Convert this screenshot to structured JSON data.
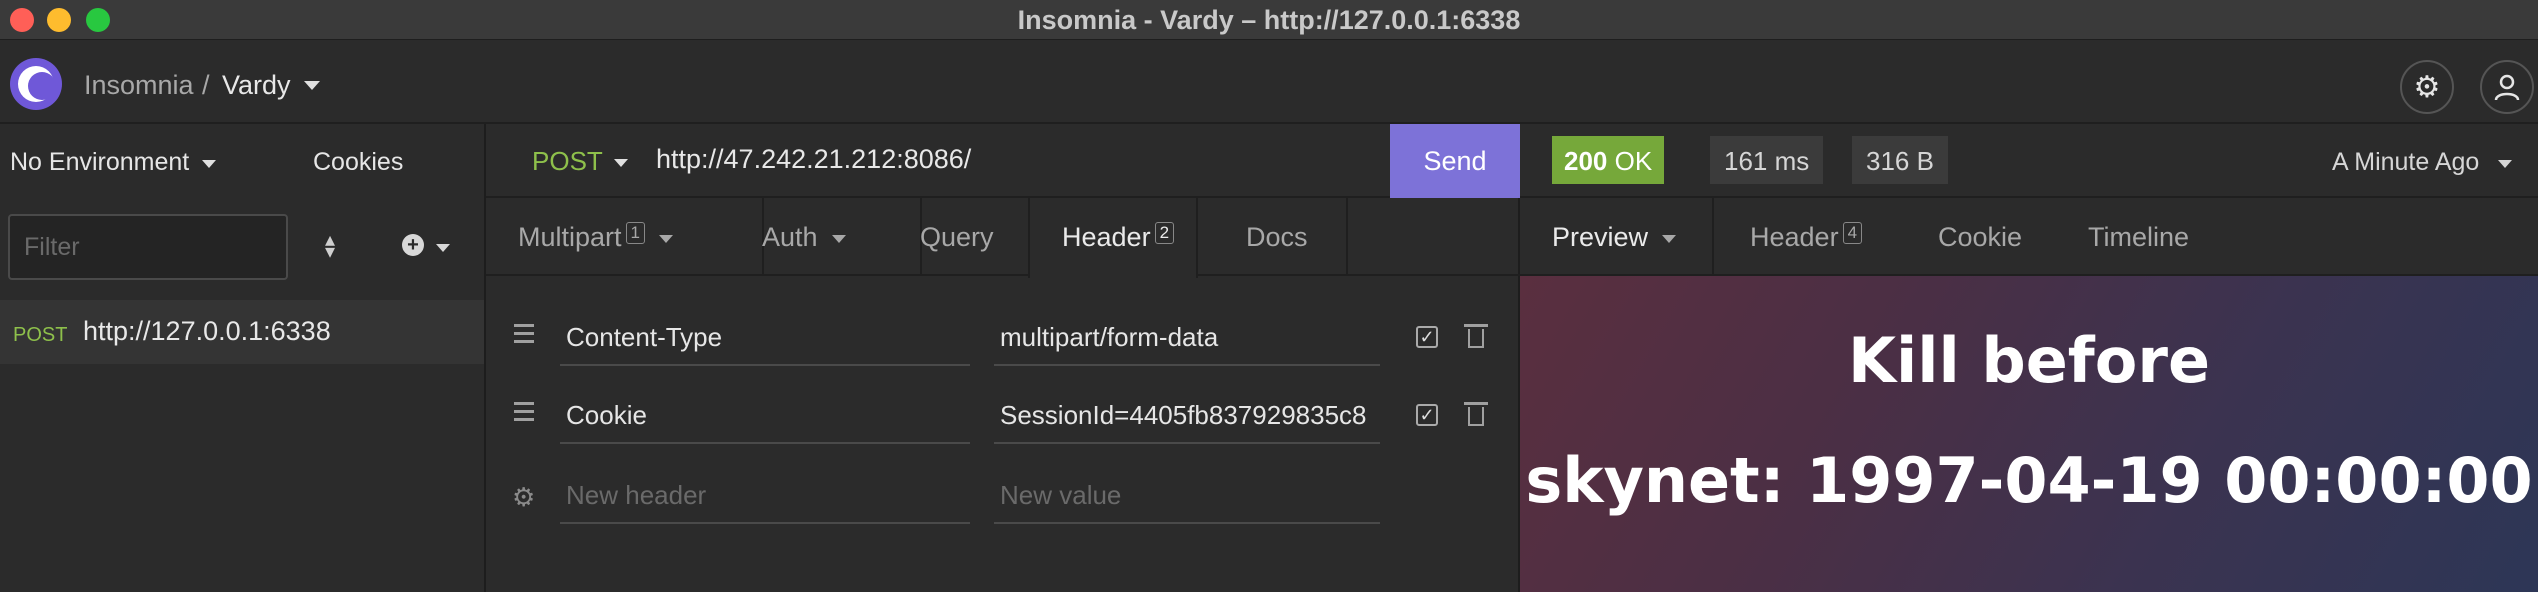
{
  "window": {
    "title": "Insomnia - Vardy – http://127.0.0.1:6338"
  },
  "header": {
    "app_name": "Insomnia",
    "separator": "/",
    "workspace": "Vardy",
    "settings_icon": "⚙",
    "account_icon": "👤"
  },
  "sidebar": {
    "environment": "No Environment",
    "cookies_label": "Cookies",
    "filter_placeholder": "Filter",
    "requests": [
      {
        "method": "POST",
        "url": "http://127.0.0.1:6338"
      }
    ]
  },
  "request": {
    "method": "POST",
    "url": "http://47.242.21.212:8086/",
    "send_label": "Send",
    "tabs": [
      {
        "label": "Multipart",
        "badge": "1"
      },
      {
        "label": "Auth"
      },
      {
        "label": "Query"
      },
      {
        "label": "Header",
        "badge": "2"
      },
      {
        "label": "Docs"
      }
    ],
    "headers": [
      {
        "name": "Content-Type",
        "value": "multipart/form-data"
      },
      {
        "name": "Cookie",
        "value": "SessionId=4405fb837929835c8"
      }
    ],
    "new_header_placeholder": "New header",
    "new_value_placeholder": "New value"
  },
  "response": {
    "status_code": "200",
    "status_text": "OK",
    "time": "161 ms",
    "size": "316 B",
    "timestamp": "A Minute Ago",
    "tabs": [
      {
        "label": "Preview"
      },
      {
        "label": "Header",
        "badge": "4"
      },
      {
        "label": "Cookie"
      },
      {
        "label": "Timeline"
      }
    ],
    "preview": {
      "line1": "Kill before",
      "line2": "skynet: 1997-04-19 00:00:00"
    }
  },
  "colors": {
    "accent": "#7d72d8",
    "method_post": "#8ec04b",
    "status_ok": "#76a83a"
  }
}
